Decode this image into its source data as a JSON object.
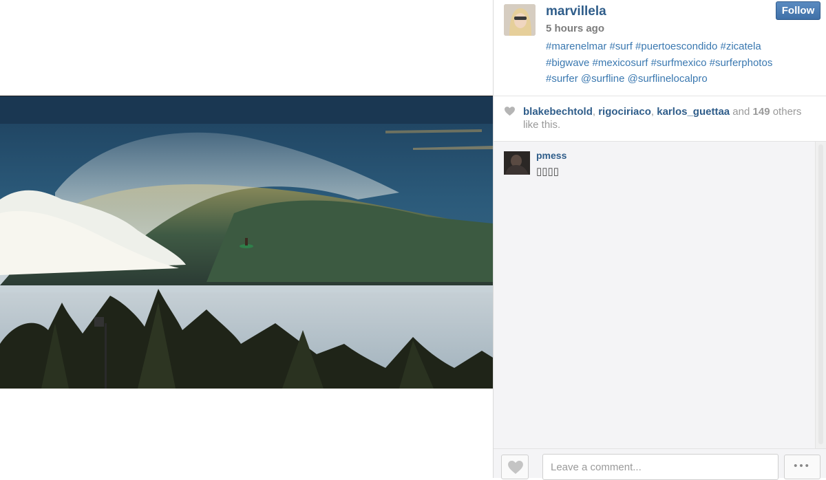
{
  "post": {
    "username": "marvillela",
    "time": "5 hours ago",
    "follow_label": "Follow",
    "caption_lines": [
      "#marenelmar #surf #puertoescondido #zicatela",
      "#bigwave #mexicosurf #surfmexico #surferphotos",
      "#surfer @surfline @surflinelocalpro"
    ]
  },
  "likes": {
    "users": [
      "blakebechtold",
      "rigociriaco",
      "karlos_guettaa"
    ],
    "sep": ", ",
    "and": " and ",
    "count": "149",
    "tail": " others like this."
  },
  "comments": [
    {
      "user": "pmess",
      "text": "▯▯▯▯"
    }
  ],
  "footer": {
    "comment_placeholder": "Leave a comment...",
    "more_label": "•••"
  },
  "colors": {
    "link": "#2f5d8a",
    "hashtag": "#3a78b0",
    "follow_button": "#4a7db5"
  }
}
